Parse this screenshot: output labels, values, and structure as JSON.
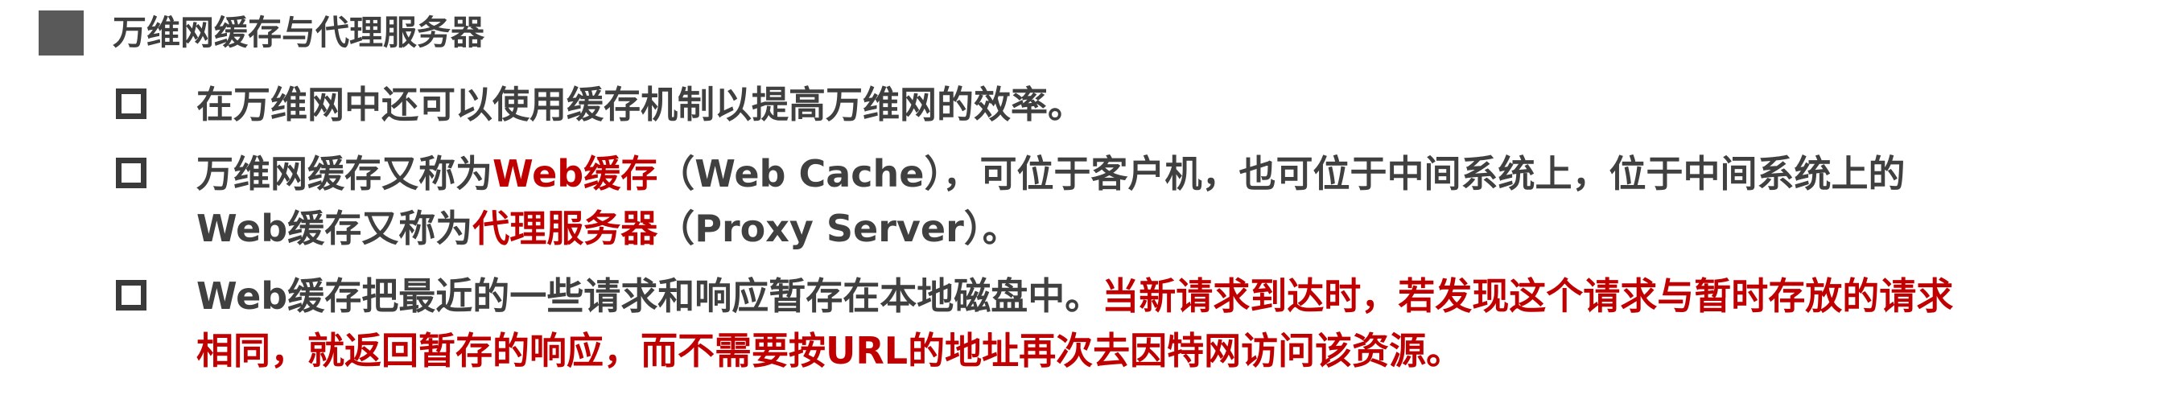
{
  "heading": {
    "title": "万维网缓存与代理服务器"
  },
  "bullets": [
    {
      "lines": [
        [
          {
            "text": "在万维网中还可以使用缓存机制以提高万维网的效率。",
            "highlight": false
          }
        ]
      ]
    },
    {
      "lines": [
        [
          {
            "text": "万维网缓存又称为",
            "highlight": false
          },
          {
            "text": "Web缓存",
            "highlight": true
          },
          {
            "text": "（Web Cache），可位于客户机，也可位于中间系统上，位于中间系统上的",
            "highlight": false
          }
        ],
        [
          {
            "text": "Web缓存又称为",
            "highlight": false
          },
          {
            "text": "代理服务器",
            "highlight": true
          },
          {
            "text": "（Proxy Server）。",
            "highlight": false
          }
        ]
      ]
    },
    {
      "lines": [
        [
          {
            "text": "Web缓存把最近的一些请求和响应暂存在本地磁盘中。",
            "highlight": false
          },
          {
            "text": "当新请求到达时，若发现这个请求与暂时存放的请求",
            "highlight": true
          }
        ],
        [
          {
            "text": "相同，就返回暂存的响应，而不需要按URL的地址再次去因特网访问该资源。",
            "highlight": true
          }
        ]
      ]
    }
  ],
  "colors": {
    "text": "#404040",
    "highlight": "#c00000",
    "heading_square": "#595959",
    "checkbox_border": "#3a3a3a"
  },
  "icons": {
    "heading_marker": "filled-square-icon",
    "bullet_marker": "checkbox-outline-icon"
  }
}
